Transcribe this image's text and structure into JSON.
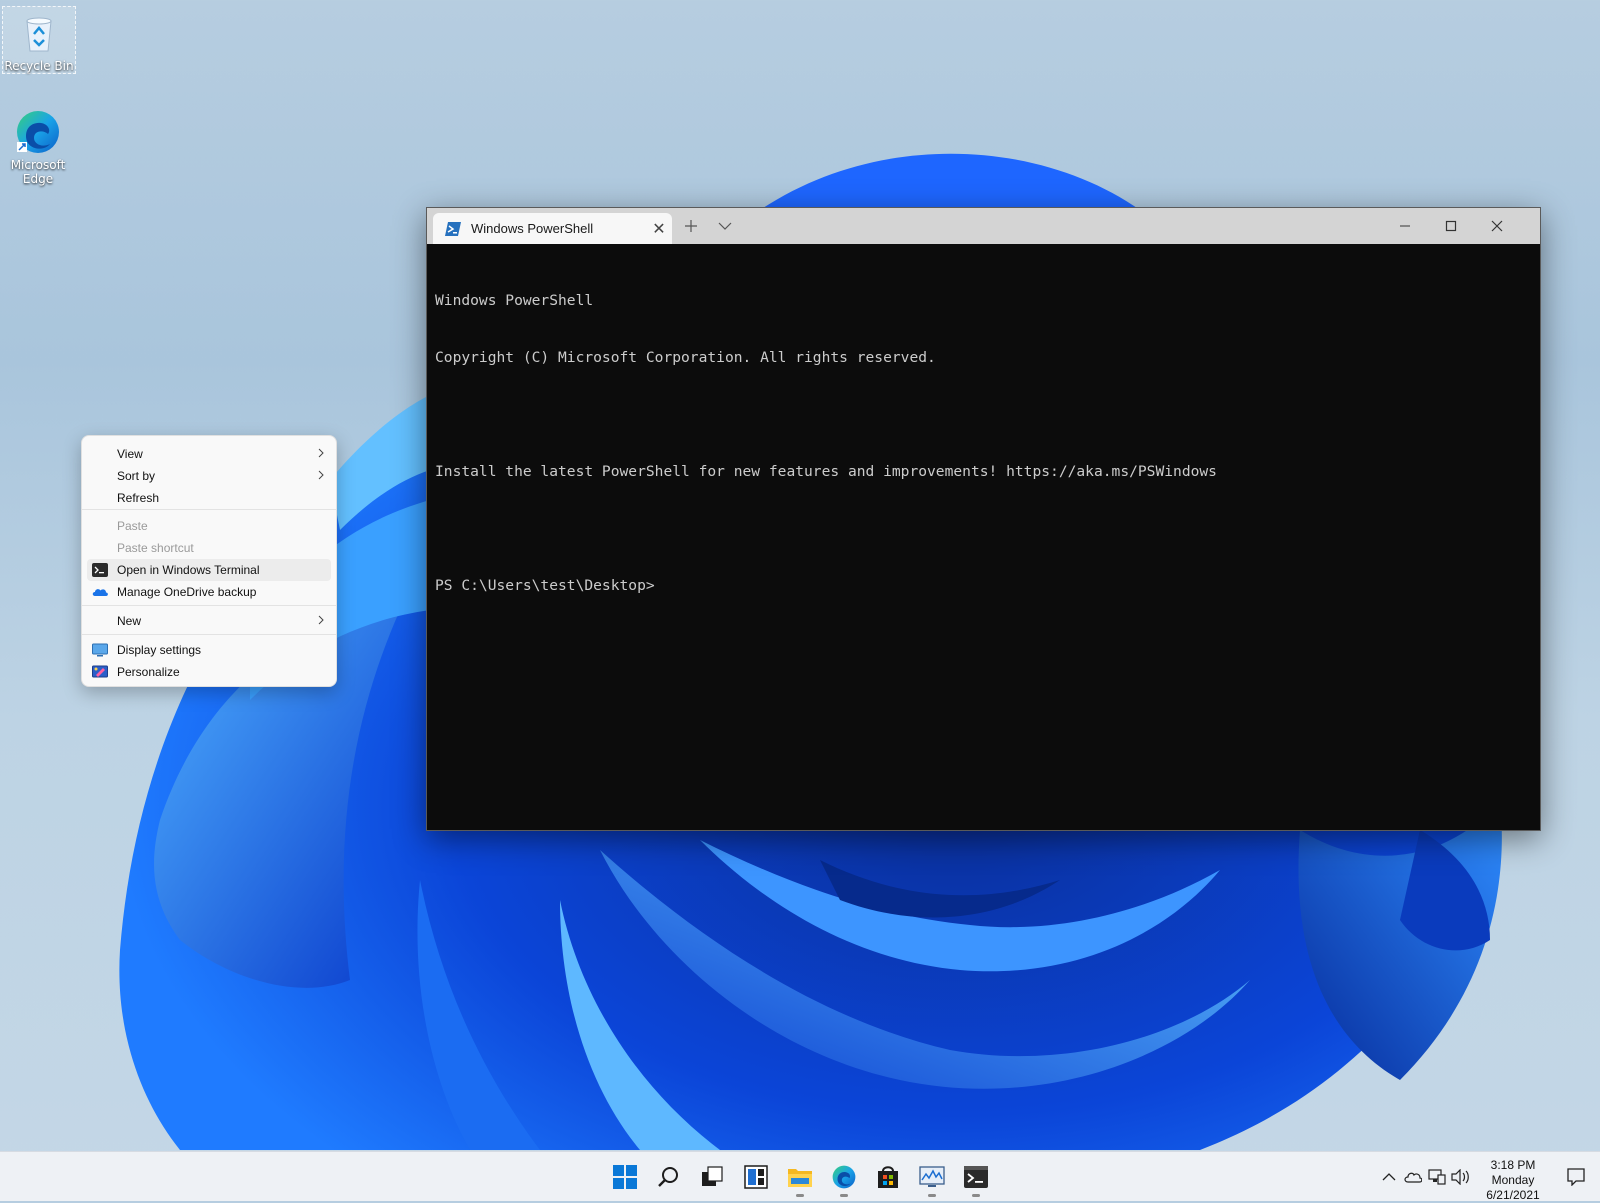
{
  "desktop": {
    "icons": [
      {
        "label": "Recycle Bin",
        "icon": "recycle-bin-icon"
      },
      {
        "label": "Microsoft Edge",
        "icon": "edge-icon"
      }
    ]
  },
  "terminal": {
    "tab_title": "Windows PowerShell",
    "lines": [
      "Windows PowerShell",
      "Copyright (C) Microsoft Corporation. All rights reserved.",
      "",
      "Install the latest PowerShell for new features and improvements! https://aka.ms/PSWindows",
      "",
      "PS C:\\Users\\test\\Desktop>"
    ],
    "colors": {
      "background": "#0c0c0c",
      "text": "#cccccc",
      "titlebar": "#d4d4d4"
    }
  },
  "context_menu": {
    "items": [
      {
        "label": "View",
        "submenu": true,
        "enabled": true
      },
      {
        "label": "Sort by",
        "submenu": true,
        "enabled": true
      },
      {
        "label": "Refresh",
        "enabled": true
      },
      {
        "label": "Paste",
        "enabled": false
      },
      {
        "label": "Paste shortcut",
        "enabled": false
      },
      {
        "label": "Open in Windows Terminal",
        "icon": "terminal-icon",
        "enabled": true,
        "highlighted": true
      },
      {
        "label": "Manage OneDrive backup",
        "icon": "onedrive-icon",
        "enabled": true
      },
      {
        "label": "New",
        "submenu": true,
        "enabled": true
      },
      {
        "label": "Display settings",
        "icon": "display-icon",
        "enabled": true
      },
      {
        "label": "Personalize",
        "icon": "personalize-icon",
        "enabled": true
      }
    ]
  },
  "taskbar": {
    "apps": [
      "start-icon",
      "search-icon",
      "task-view-icon",
      "widgets-icon",
      "file-explorer-icon",
      "edge-icon",
      "store-icon",
      "performance-monitor-icon",
      "terminal-icon"
    ],
    "tray_icons": [
      "chevron-up-icon",
      "onedrive-icon",
      "network-icon",
      "volume-icon"
    ],
    "clock": {
      "time": "3:18 PM",
      "day": "Monday",
      "date": "6/21/2021"
    },
    "notification_icon": "notification-icon"
  }
}
